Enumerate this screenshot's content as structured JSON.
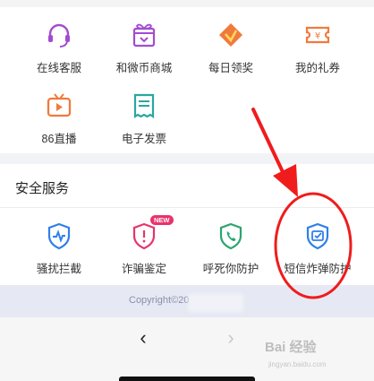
{
  "services_grid": {
    "items": [
      {
        "label": "在线客服",
        "icon": "headset-icon"
      },
      {
        "label": "和微币商城",
        "icon": "gift-shop-icon"
      },
      {
        "label": "每日领奖",
        "icon": "diamond-reward-icon"
      },
      {
        "label": "我的礼券",
        "icon": "coupon-icon"
      },
      {
        "label": "86直播",
        "icon": "tv-live-icon"
      },
      {
        "label": "电子发票",
        "icon": "invoice-icon"
      }
    ]
  },
  "security_section": {
    "title": "安全服务",
    "items": [
      {
        "label": "骚扰拦截",
        "icon": "shield-heartbeat-icon"
      },
      {
        "label": "诈骗鉴定",
        "icon": "shield-alert-icon",
        "badge": "NEW"
      },
      {
        "label": "呼死你防护",
        "icon": "shield-phone-icon"
      },
      {
        "label": "短信炸弹防护",
        "icon": "shield-message-icon"
      }
    ]
  },
  "footer": {
    "copyright": "Copyright©20"
  },
  "nav": {
    "back": "‹",
    "forward": "›"
  },
  "watermark": {
    "text": "Bai 经验",
    "sub": "jingyan.baidu.com"
  },
  "colors": {
    "purple": "#a24bd1",
    "orange": "#f07a3c",
    "blue": "#2f7fe8",
    "green": "#2aa66e",
    "pink": "#e8336d",
    "annotation_red": "#f01c1c"
  }
}
